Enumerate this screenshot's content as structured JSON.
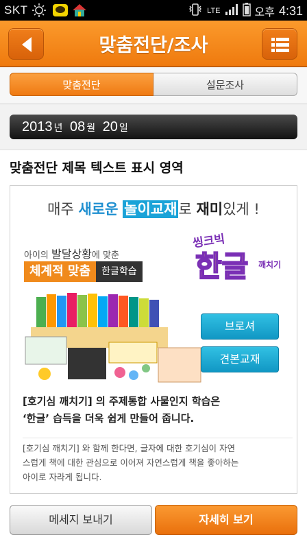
{
  "status": {
    "carrier": "SKT",
    "network": "LTE",
    "ampm": "오후",
    "time": "4:31"
  },
  "header": {
    "title": "맞춤전단/조사",
    "back_icon": "back-arrow-icon",
    "menu_icon": "list-menu-icon"
  },
  "tabs": [
    {
      "label": "맞춤전단",
      "active": true
    },
    {
      "label": "설문조사",
      "active": false
    }
  ],
  "date": {
    "year": "2013",
    "year_unit": "년",
    "month": "08",
    "month_unit": "월",
    "day": "20",
    "day_unit": "일"
  },
  "subject": "맞춤전단 제목 텍스트 표시 영역",
  "ad": {
    "headline": {
      "p1": "매주 ",
      "p2": "새로운",
      "p3": " ",
      "p4": "놀이교재",
      "p5": "로 ",
      "p6": "재미",
      "p7": "있게 !"
    },
    "tag_small_1": "아이의 ",
    "tag_large": "발달상황",
    "tag_small_2": "에 맞춘",
    "tag_orange": "체계적 맞춤",
    "tag_dark": "한글학습",
    "logo_top": "씽크빅",
    "logo_main": "한글",
    "logo_side": "깨치기",
    "brochure_button": "브로셔",
    "sample_button": "견본교재",
    "desc_line1": "[호기심 깨치기] 의 주제통합 사물인지 학습은",
    "desc_line2": "‘한글’ 습득을 더욱 쉽게 만들어 줍니다.",
    "desc_small_1": "[호기심 깨치기] 와 함께 한다면, 글자에 대한 호기심이 자연",
    "desc_small_2": "스럽게 책에 대한 관심으로 이어져 자연스럽게 책을 좋아하는",
    "desc_small_3": "아이로 자라게 됩니다."
  },
  "footer": {
    "message_button": "메세지 보내기",
    "detail_button": "자세히 보기"
  },
  "colors": {
    "accent": "#ef7a0e",
    "blue": "#1aa3d8"
  }
}
